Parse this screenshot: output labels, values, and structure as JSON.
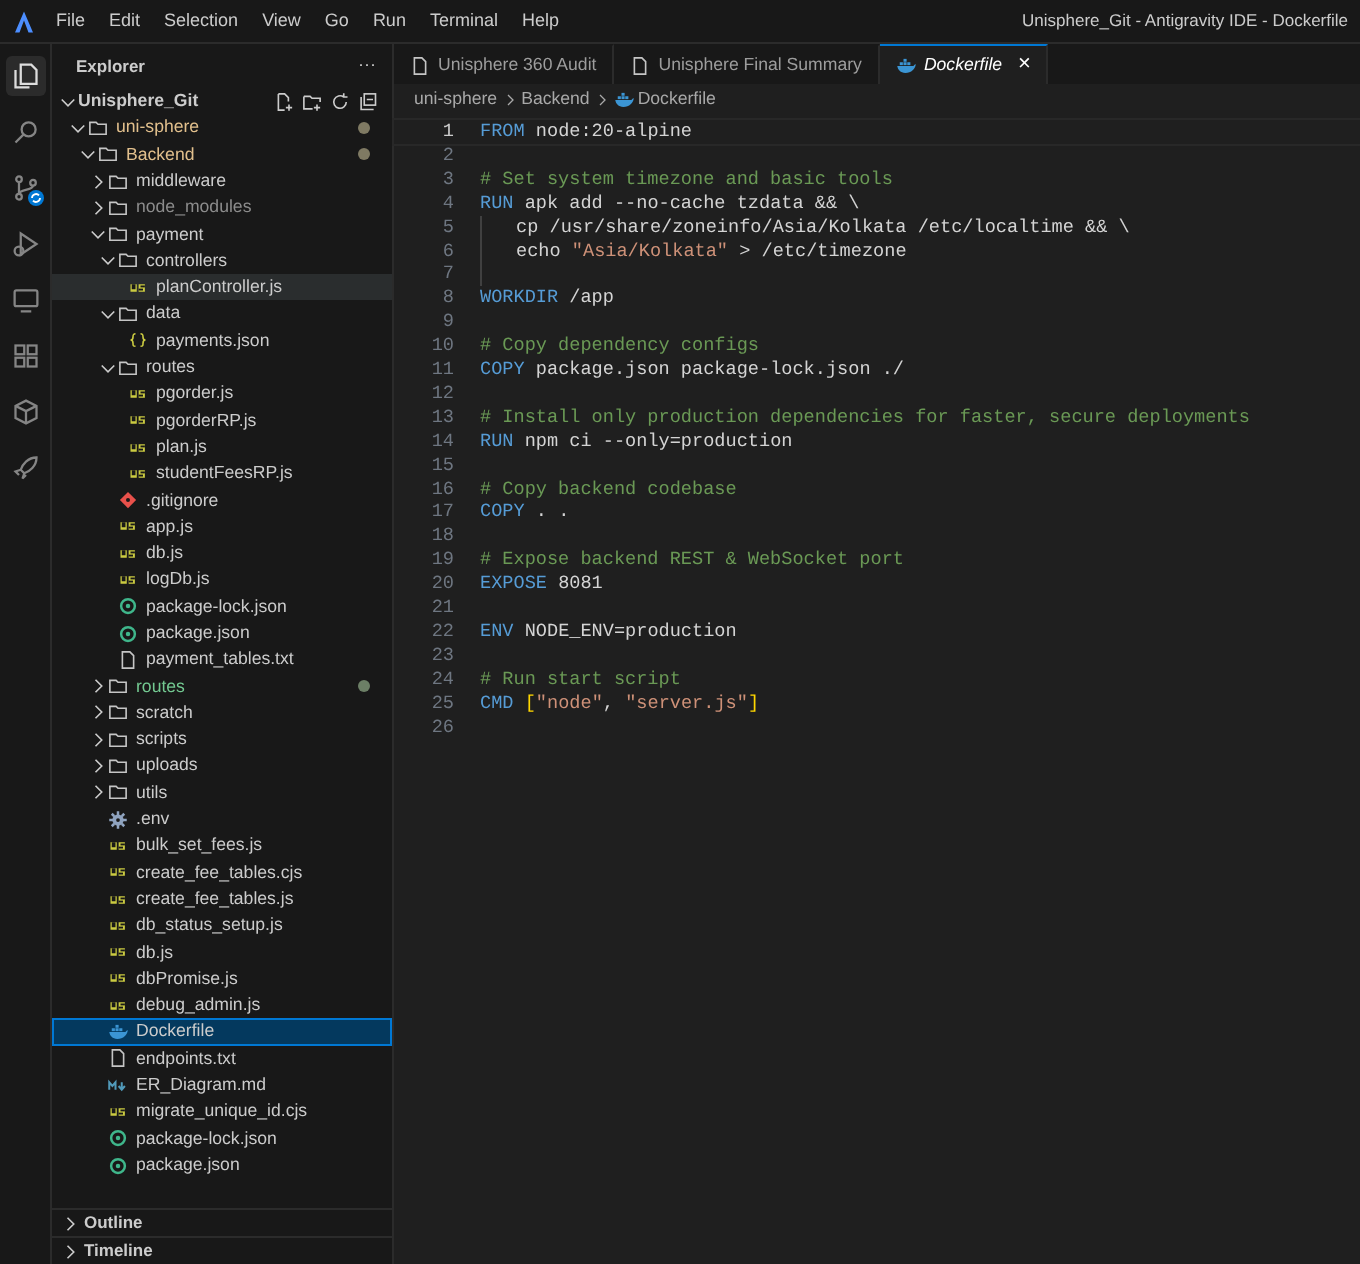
{
  "window": {
    "title": "Unisphere_Git - Antigravity IDE - Dockerfile"
  },
  "menu": [
    "File",
    "Edit",
    "Selection",
    "View",
    "Go",
    "Run",
    "Terminal",
    "Help"
  ],
  "activity_bar": [
    {
      "kind": "explorer",
      "selected": true
    },
    {
      "kind": "search",
      "selected": false
    },
    {
      "kind": "source-control",
      "selected": false
    },
    {
      "kind": "run",
      "selected": false
    },
    {
      "kind": "remote",
      "selected": false
    },
    {
      "kind": "extensions",
      "selected": false
    },
    {
      "kind": "database",
      "selected": false
    },
    {
      "kind": "rocket",
      "selected": false
    }
  ],
  "sidebar": {
    "title": "Explorer",
    "more": "···",
    "tree": {
      "label": "Unisphere_Git",
      "kind": "root",
      "expanded": true,
      "selected": false,
      "children": [
        {
          "label": "uni-sphere",
          "kind": "folder",
          "expanded": true,
          "selected": false,
          "git_modified": true,
          "children": [
            {
              "label": "Backend",
              "kind": "folder",
              "expanded": true,
              "selected": false,
              "git_modified": true,
              "children": [
                {
                  "label": "middleware",
                  "kind": "folder",
                  "expanded": false,
                  "selected": false
                },
                {
                  "label": "node_modules",
                  "kind": "folder",
                  "expanded": false,
                  "selected": false,
                  "ignored": true
                },
                {
                  "label": "payment",
                  "kind": "folder",
                  "expanded": true,
                  "selected": false,
                  "children": [
                    {
                      "label": "controllers",
                      "kind": "folder",
                      "expanded": true,
                      "selected": false,
                      "children": [
                        {
                          "label": "planController.js",
                          "kind": "js",
                          "selected": false,
                          "hovered": true
                        }
                      ]
                    },
                    {
                      "label": "data",
                      "kind": "folder",
                      "expanded": true,
                      "selected": false,
                      "children": [
                        {
                          "label": "payments.json",
                          "kind": "json",
                          "selected": false
                        }
                      ]
                    },
                    {
                      "label": "routes",
                      "kind": "folder",
                      "expanded": true,
                      "selected": false,
                      "children": [
                        {
                          "label": "pgorder.js",
                          "kind": "js",
                          "selected": false
                        },
                        {
                          "label": "pgorderRP.js",
                          "kind": "js",
                          "selected": false
                        },
                        {
                          "label": "plan.js",
                          "kind": "js",
                          "selected": false
                        },
                        {
                          "label": "studentFeesRP.js",
                          "kind": "js",
                          "selected": false
                        }
                      ]
                    },
                    {
                      "label": ".gitignore",
                      "kind": "git",
                      "selected": false
                    },
                    {
                      "label": "app.js",
                      "kind": "js",
                      "selected": false
                    },
                    {
                      "label": "db.js",
                      "kind": "js",
                      "selected": false
                    },
                    {
                      "label": "logDb.js",
                      "kind": "js",
                      "selected": false
                    },
                    {
                      "label": "package-lock.json",
                      "kind": "npm",
                      "selected": false
                    },
                    {
                      "label": "package.json",
                      "kind": "npm",
                      "selected": false
                    },
                    {
                      "label": "payment_tables.txt",
                      "kind": "text",
                      "selected": false
                    }
                  ]
                },
                {
                  "label": "routes",
                  "kind": "folder",
                  "expanded": false,
                  "selected": false,
                  "git_untracked": true
                },
                {
                  "label": "scratch",
                  "kind": "folder",
                  "expanded": false,
                  "selected": false
                },
                {
                  "label": "scripts",
                  "kind": "folder",
                  "expanded": false,
                  "selected": false
                },
                {
                  "label": "uploads",
                  "kind": "folder",
                  "expanded": false,
                  "selected": false
                },
                {
                  "label": "utils",
                  "kind": "folder",
                  "expanded": false,
                  "selected": false
                },
                {
                  "label": ".env",
                  "kind": "env",
                  "selected": false
                },
                {
                  "label": "bulk_set_fees.js",
                  "kind": "js",
                  "selected": false
                },
                {
                  "label": "create_fee_tables.cjs",
                  "kind": "js",
                  "selected": false
                },
                {
                  "label": "create_fee_tables.js",
                  "kind": "js",
                  "selected": false
                },
                {
                  "label": "db_status_setup.js",
                  "kind": "js",
                  "selected": false
                },
                {
                  "label": "db.js",
                  "kind": "js",
                  "selected": false
                },
                {
                  "label": "dbPromise.js",
                  "kind": "js",
                  "selected": false
                },
                {
                  "label": "debug_admin.js",
                  "kind": "js",
                  "selected": false
                },
                {
                  "label": "Dockerfile",
                  "kind": "docker",
                  "selected": true
                },
                {
                  "label": "endpoints.txt",
                  "kind": "text",
                  "selected": false
                },
                {
                  "label": "ER_Diagram.md",
                  "kind": "md",
                  "selected": false
                },
                {
                  "label": "migrate_unique_id.cjs",
                  "kind": "js",
                  "selected": false
                },
                {
                  "label": "package-lock.json",
                  "kind": "npm",
                  "selected": false
                },
                {
                  "label": "package.json",
                  "kind": "npm",
                  "selected": false
                }
              ]
            }
          ]
        }
      ]
    },
    "sections": [
      {
        "label": "Outline",
        "expanded": false
      },
      {
        "label": "Timeline",
        "expanded": false
      }
    ]
  },
  "tabs": [
    {
      "label": "Unisphere 360 Audit",
      "kind": "file",
      "selected": false
    },
    {
      "label": "Unisphere Final Summary",
      "kind": "file",
      "selected": false
    },
    {
      "label": "Dockerfile",
      "kind": "docker",
      "selected": true,
      "preview": true,
      "close": "×"
    }
  ],
  "breadcrumbs": [
    {
      "label": "uni-sphere",
      "kind": "folder"
    },
    {
      "label": "Backend",
      "kind": "folder"
    },
    {
      "label": "Dockerfile",
      "kind": "docker"
    }
  ],
  "code": [
    {
      "number": "1",
      "current": true,
      "tokens": [
        {
          "kind": "keyword",
          "text": "FROM"
        },
        {
          "kind": "plain",
          "text": " node:20-alpine"
        }
      ]
    },
    {
      "number": "2"
    },
    {
      "number": "3",
      "tokens": [
        {
          "kind": "comment",
          "text": "# Set system timezone and basic tools"
        }
      ]
    },
    {
      "number": "4",
      "tokens": [
        {
          "kind": "keyword",
          "text": "RUN"
        },
        {
          "kind": "plain",
          "text": " apk add --no-cache tzdata && \\"
        }
      ]
    },
    {
      "number": "5",
      "indented": true,
      "tokens": [
        {
          "kind": "plain",
          "text": "cp /usr/share/zoneinfo/Asia/Kolkata /etc/localtime && \\"
        }
      ]
    },
    {
      "number": "6",
      "indented": true,
      "tokens": [
        {
          "kind": "plain",
          "text": "echo "
        },
        {
          "kind": "string",
          "text": "\"Asia/Kolkata\""
        },
        {
          "kind": "plain",
          "text": " > /etc/timezone"
        }
      ]
    },
    {
      "number": "7",
      "indented": true
    },
    {
      "number": "8",
      "tokens": [
        {
          "kind": "keyword",
          "text": "WORKDIR"
        },
        {
          "kind": "plain",
          "text": " /app"
        }
      ]
    },
    {
      "number": "9"
    },
    {
      "number": "10",
      "tokens": [
        {
          "kind": "comment",
          "text": "# Copy dependency configs"
        }
      ]
    },
    {
      "number": "11",
      "tokens": [
        {
          "kind": "keyword",
          "text": "COPY"
        },
        {
          "kind": "plain",
          "text": " package.json package-lock.json ./"
        }
      ]
    },
    {
      "number": "12"
    },
    {
      "number": "13",
      "tokens": [
        {
          "kind": "comment",
          "text": "# Install only production dependencies for faster, secure deployments"
        }
      ]
    },
    {
      "number": "14",
      "tokens": [
        {
          "kind": "keyword",
          "text": "RUN"
        },
        {
          "kind": "plain",
          "text": " npm ci --only=production"
        }
      ]
    },
    {
      "number": "15"
    },
    {
      "number": "16",
      "tokens": [
        {
          "kind": "comment",
          "text": "# Copy backend codebase"
        }
      ]
    },
    {
      "number": "17",
      "tokens": [
        {
          "kind": "keyword",
          "text": "COPY"
        },
        {
          "kind": "plain",
          "text": " . ."
        }
      ]
    },
    {
      "number": "18"
    },
    {
      "number": "19",
      "tokens": [
        {
          "kind": "comment",
          "text": "# Expose backend REST & WebSocket port"
        }
      ]
    },
    {
      "number": "20",
      "tokens": [
        {
          "kind": "keyword",
          "text": "EXPOSE"
        },
        {
          "kind": "plain",
          "text": " 8081"
        }
      ]
    },
    {
      "number": "21"
    },
    {
      "number": "22",
      "tokens": [
        {
          "kind": "keyword",
          "text": "ENV"
        },
        {
          "kind": "plain",
          "text": " NODE_ENV=production"
        }
      ]
    },
    {
      "number": "23"
    },
    {
      "number": "24",
      "tokens": [
        {
          "kind": "comment",
          "text": "# Run start script"
        }
      ]
    },
    {
      "number": "25",
      "tokens": [
        {
          "kind": "keyword",
          "text": "CMD"
        },
        {
          "kind": "bracket",
          "text": " ["
        },
        {
          "kind": "string",
          "text": "\"node\""
        },
        {
          "kind": "plain",
          "text": ", "
        },
        {
          "kind": "string",
          "text": "\"server.js\""
        },
        {
          "kind": "bracket",
          "text": "]"
        }
      ]
    },
    {
      "number": "26"
    }
  ]
}
